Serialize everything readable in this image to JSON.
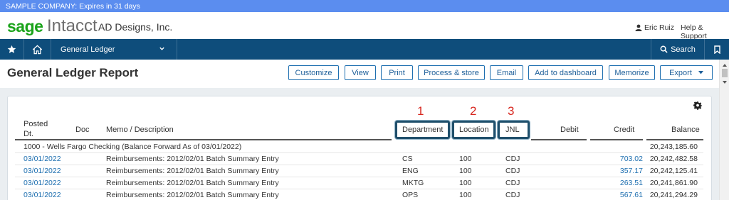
{
  "banner": {
    "text": "SAMPLE COMPANY: Expires in 31 days"
  },
  "header": {
    "logo_brand": "sage",
    "logo_product": "Intacct",
    "company": "AD Designs, Inc.",
    "user": "Eric Ruiz",
    "help": "Help & Support",
    "user_icon": "person-icon"
  },
  "nav": {
    "module": "General Ledger",
    "search": "Search",
    "icons": [
      "star-icon",
      "home-icon",
      "chevron-down-icon",
      "search-icon",
      "bookmark-icon"
    ]
  },
  "page": {
    "title": "General Ledger Report",
    "buttons": {
      "customize": "Customize",
      "view": "View",
      "print": "Print",
      "process_store": "Process & store",
      "email": "Email",
      "add_dashboard": "Add to dashboard",
      "memorize": "Memorize",
      "export": "Export"
    }
  },
  "annotations": {
    "one": "1",
    "two": "2",
    "three": "3"
  },
  "table": {
    "headers": {
      "posted_line1": "Posted",
      "posted_line2": "Dt.",
      "doc": "Doc",
      "memo": "Memo / Description",
      "department": "Department",
      "location": "Location",
      "jnl": "JNL",
      "debit": "Debit",
      "credit": "Credit",
      "balance": "Balance"
    },
    "forward": {
      "label": "1000 - Wells Fargo Checking (Balance Forward As of 03/01/2022)",
      "balance": "20,243,185.60"
    },
    "rows": [
      {
        "date": "03/01/2022",
        "memo": "Reimbursements: 2012/02/01 Batch Summary Entry",
        "dept": "CS",
        "loc": "100",
        "jnl": "CDJ",
        "credit": "703.02",
        "balance": "20,242,482.58"
      },
      {
        "date": "03/01/2022",
        "memo": "Reimbursements: 2012/02/01 Batch Summary Entry",
        "dept": "ENG",
        "loc": "100",
        "jnl": "CDJ",
        "credit": "357.17",
        "balance": "20,242,125.41"
      },
      {
        "date": "03/01/2022",
        "memo": "Reimbursements: 2012/02/01 Batch Summary Entry",
        "dept": "MKTG",
        "loc": "100",
        "jnl": "CDJ",
        "credit": "263.51",
        "balance": "20,241,861.90"
      },
      {
        "date": "03/01/2022",
        "memo": "Reimbursements: 2012/02/01 Batch Summary Entry",
        "dept": "OPS",
        "loc": "100",
        "jnl": "CDJ",
        "credit": "567.61",
        "balance": "20,241,294.29"
      }
    ]
  },
  "colors": {
    "banner": "#5b8def",
    "nav": "#0e4d7b",
    "brand_green": "#1aa31a",
    "link": "#1e6fb0",
    "annotation": "#d7261e"
  }
}
